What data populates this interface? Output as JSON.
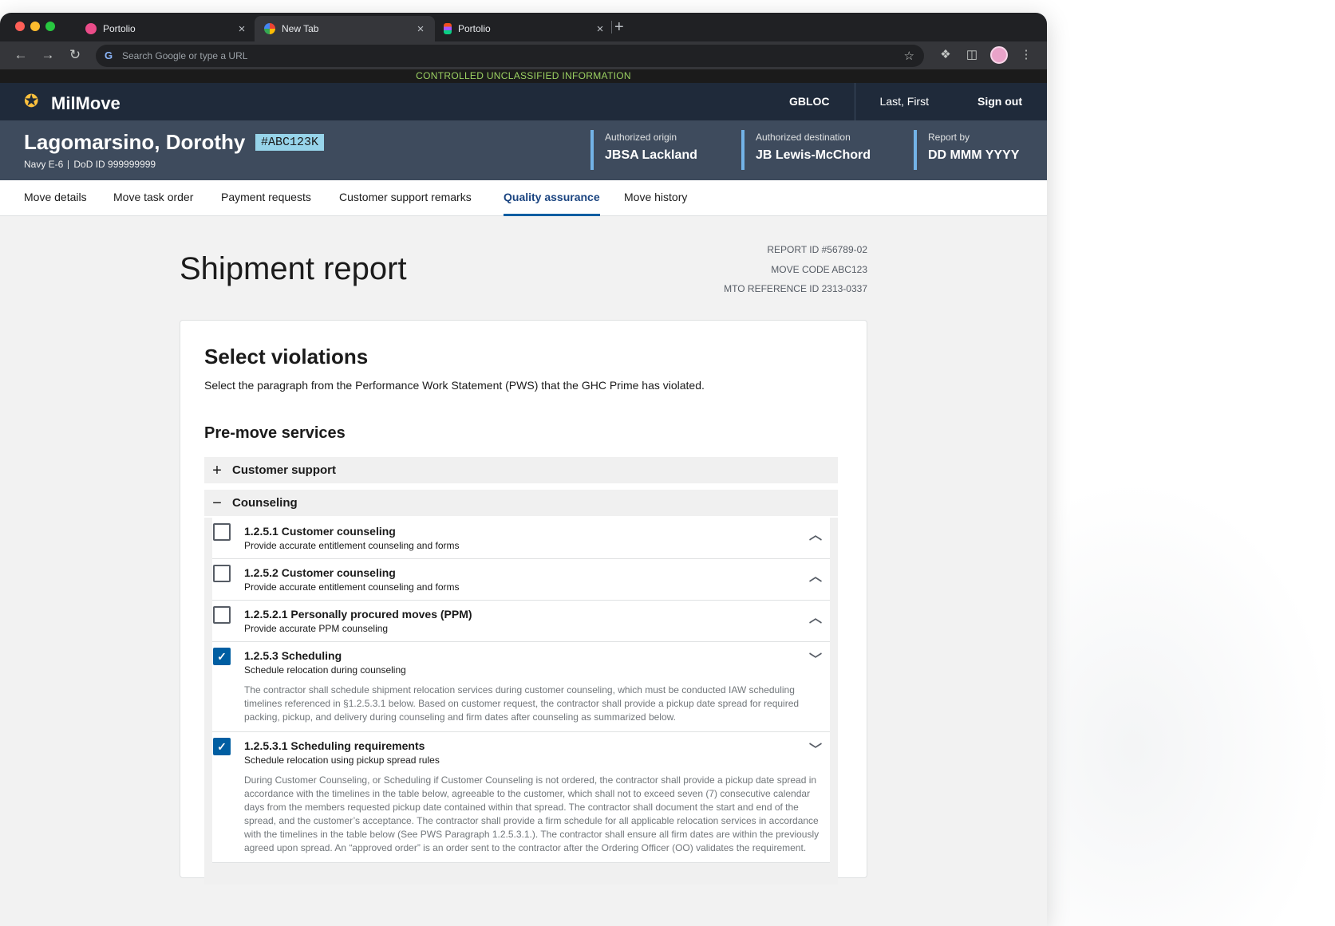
{
  "browser": {
    "tabs": [
      {
        "label": "Portolio",
        "favicon": "dribbble-icon",
        "active": false
      },
      {
        "label": "New Tab",
        "favicon": "google-icon",
        "active": true
      },
      {
        "label": "Portolio",
        "favicon": "figma-icon",
        "active": false
      }
    ],
    "close_glyph": "×",
    "new_tab_glyph": "+",
    "omnibox_placeholder": "Search Google or type a URL"
  },
  "banner": "CONTROLLED UNCLASSIFIED INFORMATION",
  "header": {
    "app_name": "MilMove",
    "gbloc": "GBLOC",
    "user": "Last, First",
    "sign_out": "Sign out"
  },
  "customer": {
    "name": "Lagomarsino, Dorothy",
    "tag": "#ABC123K",
    "rank": "Navy E-6",
    "dod_id": "DoD ID 999999999",
    "info": [
      {
        "label": "Authorized origin",
        "value": "JBSA Lackland"
      },
      {
        "label": "Authorized destination",
        "value": "JB Lewis-McChord"
      },
      {
        "label": "Report by",
        "value": "DD MMM YYYY"
      }
    ]
  },
  "tabs": [
    "Move details",
    "Move task order",
    "Payment requests",
    "Customer support remarks",
    "Quality assurance",
    "Move history"
  ],
  "active_tab": "Quality assurance",
  "page": {
    "title": "Shipment report",
    "report_id": "REPORT ID #56789-02",
    "move_code": "MOVE CODE ABC123",
    "mto_ref": "MTO REFERENCE ID 2313-0337"
  },
  "violations": {
    "heading": "Select violations",
    "description": "Select the paragraph from the Performance Work Statement (PWS) that the GHC Prime has violated.",
    "section": "Pre-move services",
    "accordions": [
      {
        "label": "Customer support",
        "expanded": false,
        "icon": "+"
      },
      {
        "label": "Counseling",
        "expanded": true,
        "icon": "−"
      }
    ],
    "items": [
      {
        "title": "1.2.5.1 Customer counseling",
        "subtitle": "Provide accurate entitlement counseling and forms",
        "checked": false,
        "chevron": "up",
        "body": ""
      },
      {
        "title": "1.2.5.2 Customer counseling",
        "subtitle": "Provide accurate entitlement counseling and forms",
        "checked": false,
        "chevron": "up",
        "body": ""
      },
      {
        "title": "1.2.5.2.1 Personally procured moves (PPM)",
        "subtitle": "Provide accurate PPM counseling",
        "checked": false,
        "chevron": "up",
        "body": ""
      },
      {
        "title": "1.2.5.3 Scheduling",
        "subtitle": "Schedule relocation during counseling",
        "checked": true,
        "chevron": "down",
        "body": "The contractor shall schedule shipment relocation services during customer counseling, which must be conducted IAW scheduling timelines referenced in §1.2.5.3.1 below.  Based on customer request, the contractor shall provide a pickup date spread for required packing, pickup, and delivery during counseling and firm dates after counseling as summarized below."
      },
      {
        "title": "1.2.5.3.1 Scheduling requirements",
        "subtitle": "Schedule relocation using pickup spread rules",
        "checked": true,
        "chevron": "down",
        "body": "During Customer Counseling, or Scheduling if Customer Counseling is not ordered, the contractor shall provide a pickup date spread in accordance with the timelines in the table below, agreeable to the customer, which shall not to exceed seven (7) consecutive calendar days from the members requested pickup date contained within that spread. The contractor shall document the start and end of the spread, and the customer’s acceptance. The contractor shall provide a firm schedule for all applicable relocation services in accordance with the timelines in the table below (See PWS Paragraph 1.2.5.3.1.). The contractor shall ensure all firm dates are within the previously agreed upon spread. An “approved order” is an order sent to the contractor after the Ordering Officer (OO) validates the requirement."
      }
    ]
  }
}
